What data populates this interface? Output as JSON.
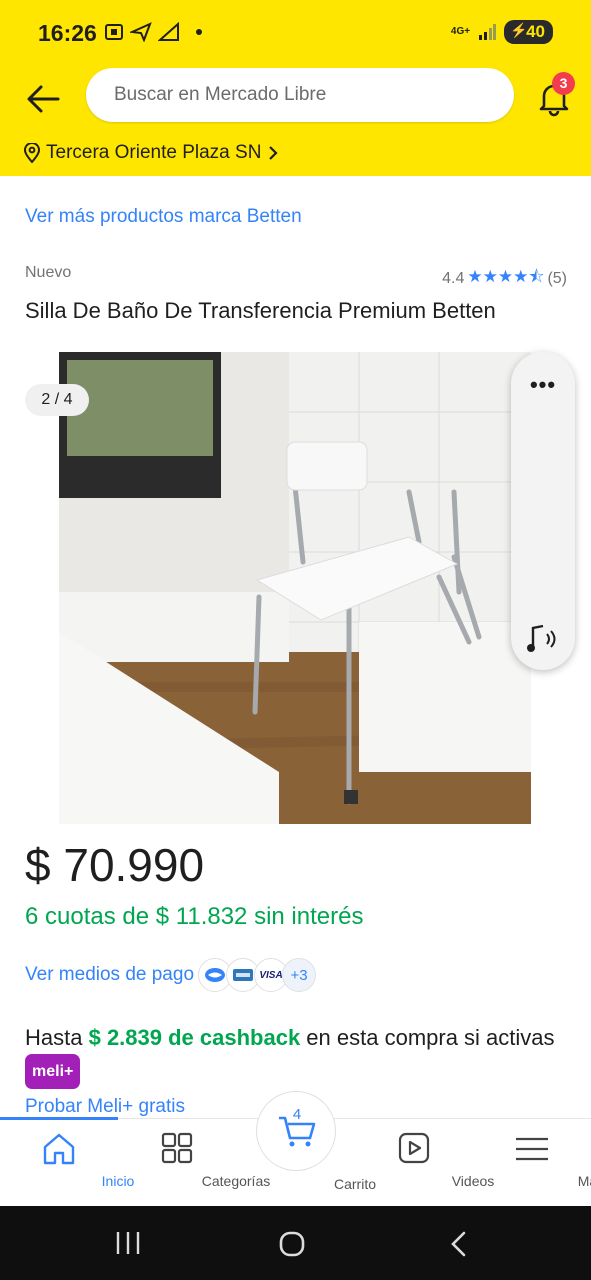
{
  "status_bar": {
    "time": "16:26",
    "network": "4G+",
    "battery": "40"
  },
  "header": {
    "search_placeholder": "Buscar en Mercado Libre",
    "notification_count": "3",
    "location": "Tercera Oriente Plaza SN"
  },
  "product": {
    "brand_link": "Ver más productos marca Betten",
    "condition": "Nuevo",
    "rating": "4.4",
    "stars": "★★★★⯪",
    "reviews": "(5)",
    "title": "Silla De Baño De Transferencia Premium Betten",
    "gallery_counter": "2 / 4",
    "price": "$ 70.990",
    "installments": "6 cuotas de $ 11.832 sin interés",
    "payment_link": "Ver medios de pago",
    "payment_more": "+3",
    "payment_visa": "VISA",
    "cashback_prefix": "Hasta ",
    "cashback_amount": "$ 2.839 de cashback",
    "cashback_suffix": " en esta compra si activas ",
    "meli_badge": "meli+",
    "try_link": "Probar Meli+ gratis"
  },
  "float_panel": {
    "menu": "•••"
  },
  "bottom_nav": {
    "items": [
      {
        "label": "Inicio"
      },
      {
        "label": "Categorías"
      },
      {
        "label": "Carrito"
      },
      {
        "label": "Videos"
      },
      {
        "label": "Más"
      }
    ],
    "cart_count": "4"
  },
  "colors": {
    "brand_yellow": "#ffe600",
    "link_blue": "#3483fa",
    "success_green": "#00a650",
    "meli_purple": "#a21fb8",
    "badge_red": "#f23d4f"
  }
}
